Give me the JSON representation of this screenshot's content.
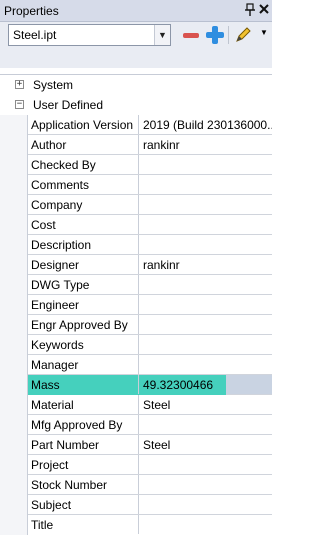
{
  "panel": {
    "title": "Properties",
    "pin_icon": "pin-icon",
    "close_icon": "close-icon"
  },
  "toolbar": {
    "file": "Steel.ipt",
    "dropdown_icon": "chevron-down-icon",
    "remove_icon": "minus-icon",
    "add_icon": "plus-icon",
    "edit_icon": "pencil-icon"
  },
  "sections": [
    {
      "label": "System",
      "expanded": false
    },
    {
      "label": "User Defined",
      "expanded": true
    }
  ],
  "rows": [
    {
      "name": "Application Version",
      "value": "2019 (Build 230136000..."
    },
    {
      "name": "Author",
      "value": "rankinr"
    },
    {
      "name": "Checked By",
      "value": ""
    },
    {
      "name": "Comments",
      "value": ""
    },
    {
      "name": "Company",
      "value": ""
    },
    {
      "name": "Cost",
      "value": ""
    },
    {
      "name": "Description",
      "value": ""
    },
    {
      "name": "Designer",
      "value": "rankinr"
    },
    {
      "name": "DWG Type",
      "value": ""
    },
    {
      "name": "Engineer",
      "value": ""
    },
    {
      "name": "Engr Approved By",
      "value": ""
    },
    {
      "name": "Keywords",
      "value": ""
    },
    {
      "name": "Manager",
      "value": ""
    },
    {
      "name": "Mass",
      "value": "49.32300466"
    },
    {
      "name": "Material",
      "value": "Steel"
    },
    {
      "name": "Mfg Approved By",
      "value": ""
    },
    {
      "name": "Part Number",
      "value": "Steel"
    },
    {
      "name": "Project",
      "value": ""
    },
    {
      "name": "Stock Number",
      "value": ""
    },
    {
      "name": "Subject",
      "value": ""
    },
    {
      "name": "Title",
      "value": ""
    }
  ],
  "colors": {
    "highlight": "#45d0bd",
    "selected_row": "#c9d3e2",
    "titlebar": "#d6dbe9"
  }
}
